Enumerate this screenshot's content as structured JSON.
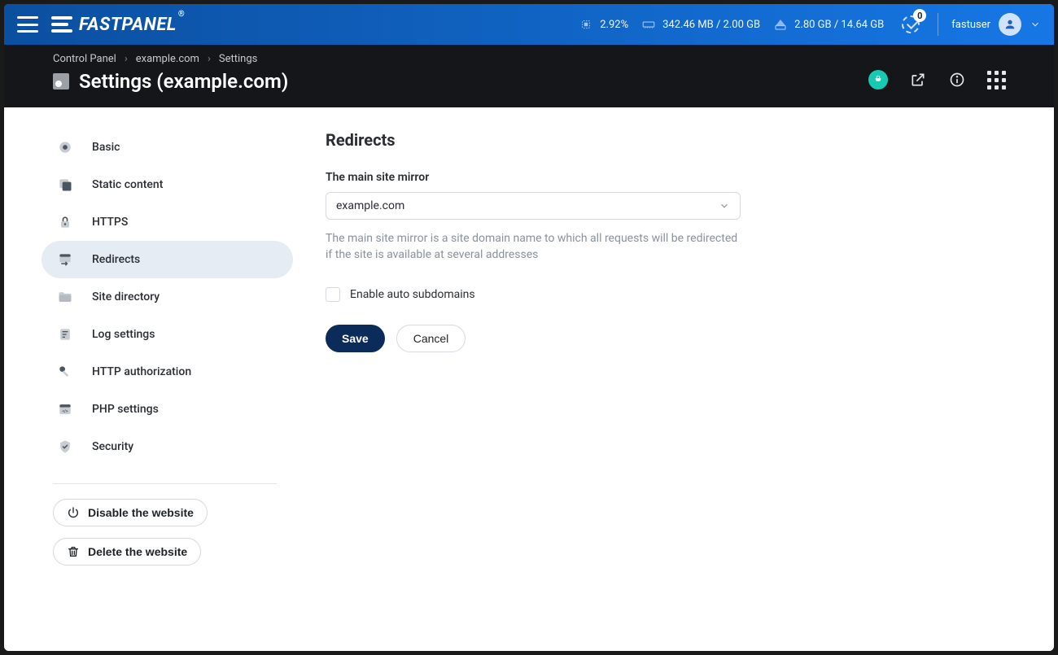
{
  "header": {
    "brand": "FASTPANEL",
    "brand_reg": "®",
    "cpu": "2.92%",
    "ram": "342.46 MB / 2.00 GB",
    "disk": "2.80 GB / 14.64 GB",
    "tasks_badge": "0",
    "username": "fastuser"
  },
  "breadcrumb": {
    "items": [
      "Control Panel",
      "example.com",
      "Settings"
    ]
  },
  "page": {
    "title": "Settings (example.com)"
  },
  "sidebar": {
    "items": [
      {
        "label": "Basic"
      },
      {
        "label": "Static content"
      },
      {
        "label": "HTTPS"
      },
      {
        "label": "Redirects",
        "active": true
      },
      {
        "label": "Site directory"
      },
      {
        "label": "Log settings"
      },
      {
        "label": "HTTP authorization"
      },
      {
        "label": "PHP settings"
      },
      {
        "label": "Security"
      }
    ],
    "disable_label": "Disable the website",
    "delete_label": "Delete the website"
  },
  "main": {
    "section_title": "Redirects",
    "mirror_label": "The main site mirror",
    "mirror_value": "example.com",
    "mirror_help": "The main site mirror is a site domain name to which all requests will be redirected if the site is available at several addresses",
    "auto_sub_label": "Enable auto subdomains",
    "save_label": "Save",
    "cancel_label": "Cancel"
  }
}
